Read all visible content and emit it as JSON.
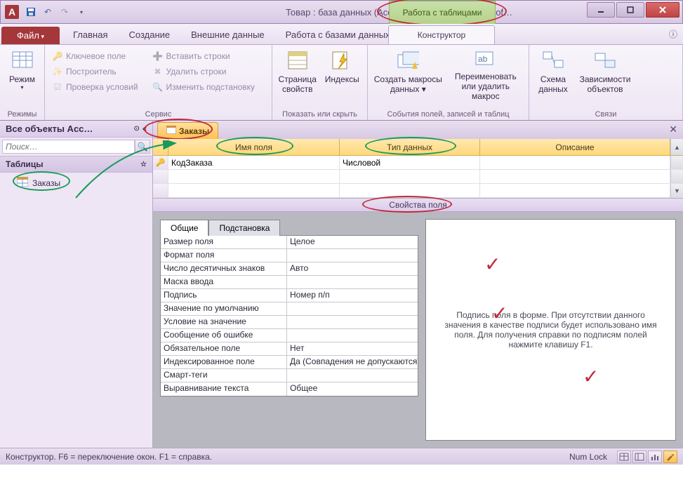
{
  "titlebar": {
    "app_letter": "A",
    "title": "Товар : база данных (Access 2007 - 2010) - Microsof…",
    "contextual_tab_group": "Работа с таблицами"
  },
  "ribbon_tabs": {
    "file": "Файл",
    "items": [
      "Главная",
      "Создание",
      "Внешние данные",
      "Работа с базами данных"
    ],
    "contextual": "Конструктор",
    "help_symbol": "ⓘ"
  },
  "ribbon": {
    "groups": [
      {
        "name": "Режимы",
        "large": [
          {
            "label": "Режим",
            "dropdown": true
          }
        ]
      },
      {
        "name": "Сервис",
        "small": [
          {
            "label": "Ключевое поле"
          },
          {
            "label": "Построитель"
          },
          {
            "label": "Проверка условий"
          },
          {
            "label": "Вставить строки"
          },
          {
            "label": "Удалить строки"
          },
          {
            "label": "Изменить подстановку"
          }
        ]
      },
      {
        "name": "Показать или скрыть",
        "large": [
          {
            "label": "Страница свойств"
          },
          {
            "label": "Индексы"
          }
        ]
      },
      {
        "name": "События полей, записей и таблиц",
        "large": [
          {
            "label": "Создать макросы данных ▾"
          },
          {
            "label": "Переименовать или удалить макрос"
          }
        ]
      },
      {
        "name": "Связи",
        "large": [
          {
            "label": "Схема данных"
          },
          {
            "label": "Зависимости объектов"
          }
        ]
      }
    ]
  },
  "navpane": {
    "title": "Все объекты Acc…",
    "search_placeholder": "Поиск…",
    "group_title": "Таблицы",
    "item": "Заказы"
  },
  "doc": {
    "tab": "Заказы",
    "headers": {
      "name": "Имя поля",
      "type": "Тип данных",
      "desc": "Описание"
    },
    "rows": [
      {
        "name": "КодЗаказа",
        "type": "Числовой",
        "desc": "",
        "pk": true
      }
    ],
    "props_label": "Свойства поля"
  },
  "props": {
    "tabs": {
      "general": "Общие",
      "lookup": "Подстановка"
    },
    "rows": [
      {
        "name": "Размер поля",
        "value": "Целое"
      },
      {
        "name": "Формат поля",
        "value": ""
      },
      {
        "name": "Число десятичных знаков",
        "value": "Авто"
      },
      {
        "name": "Маска ввода",
        "value": ""
      },
      {
        "name": "Подпись",
        "value": "Номер п/п"
      },
      {
        "name": "Значение по умолчанию",
        "value": ""
      },
      {
        "name": "Условие на значение",
        "value": ""
      },
      {
        "name": "Сообщение об ошибке",
        "value": ""
      },
      {
        "name": "Обязательное поле",
        "value": "Нет"
      },
      {
        "name": "Индексированное поле",
        "value": "Да (Совпадения не допускаются)"
      },
      {
        "name": "Смарт-теги",
        "value": ""
      },
      {
        "name": "Выравнивание текста",
        "value": "Общее"
      }
    ],
    "help": "Подпись поля в форме. При отсутствии данного значения в качестве подписи будет использовано имя поля. Для получения справки по подписям полей нажмите клавишу F1."
  },
  "statusbar": {
    "left": "Конструктор.  F6 = переключение окон.  F1 = справка.",
    "indicator": "Num Lock"
  }
}
